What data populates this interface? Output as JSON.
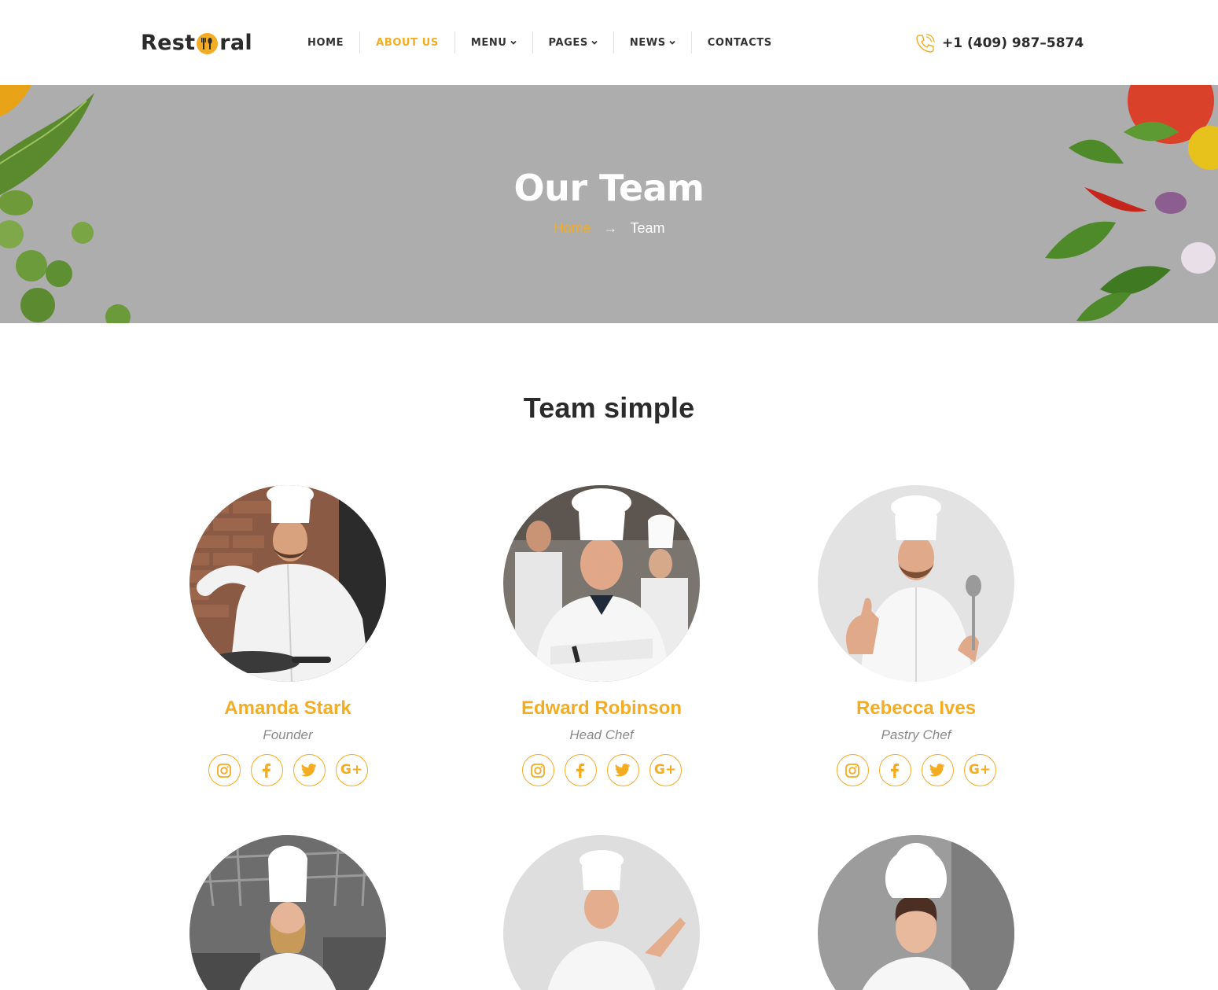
{
  "brand": {
    "logo_left": "Rest",
    "logo_right": "ral",
    "accent": "#f4ac23"
  },
  "nav": {
    "items": [
      {
        "label": "HOME",
        "dropdown": false,
        "active": false
      },
      {
        "label": "ABOUT US",
        "dropdown": false,
        "active": true
      },
      {
        "label": "MENU",
        "dropdown": true,
        "active": false
      },
      {
        "label": "PAGES",
        "dropdown": true,
        "active": false
      },
      {
        "label": "NEWS",
        "dropdown": true,
        "active": false
      },
      {
        "label": "CONTACTS",
        "dropdown": false,
        "active": false
      }
    ]
  },
  "contact": {
    "phone": "+1 (409) 987–5874",
    "icon": "phone-icon"
  },
  "hero": {
    "title": "Our Team",
    "breadcrumb": {
      "home": "Home",
      "separator": "→",
      "current": "Team"
    }
  },
  "section": {
    "title": "Team simple"
  },
  "team": [
    {
      "name": "Amanda Stark",
      "role": "Founder",
      "photo": "chef-cooking-photo"
    },
    {
      "name": "Edward Robinson",
      "role": "Head Chef",
      "photo": "chef-crossed-arms-photo"
    },
    {
      "name": "Rebecca Ives",
      "role": "Pastry Chef",
      "photo": "chef-thumbs-up-photo"
    },
    {
      "name": "",
      "role": "",
      "photo": "female-chef-kitchen-photo"
    },
    {
      "name": "",
      "role": "",
      "photo": "chef-pointing-photo"
    },
    {
      "name": "",
      "role": "",
      "photo": "female-chef-smiling-photo"
    }
  ],
  "socials": [
    "instagram-icon",
    "facebook-icon",
    "twitter-icon",
    "google-plus-icon"
  ]
}
